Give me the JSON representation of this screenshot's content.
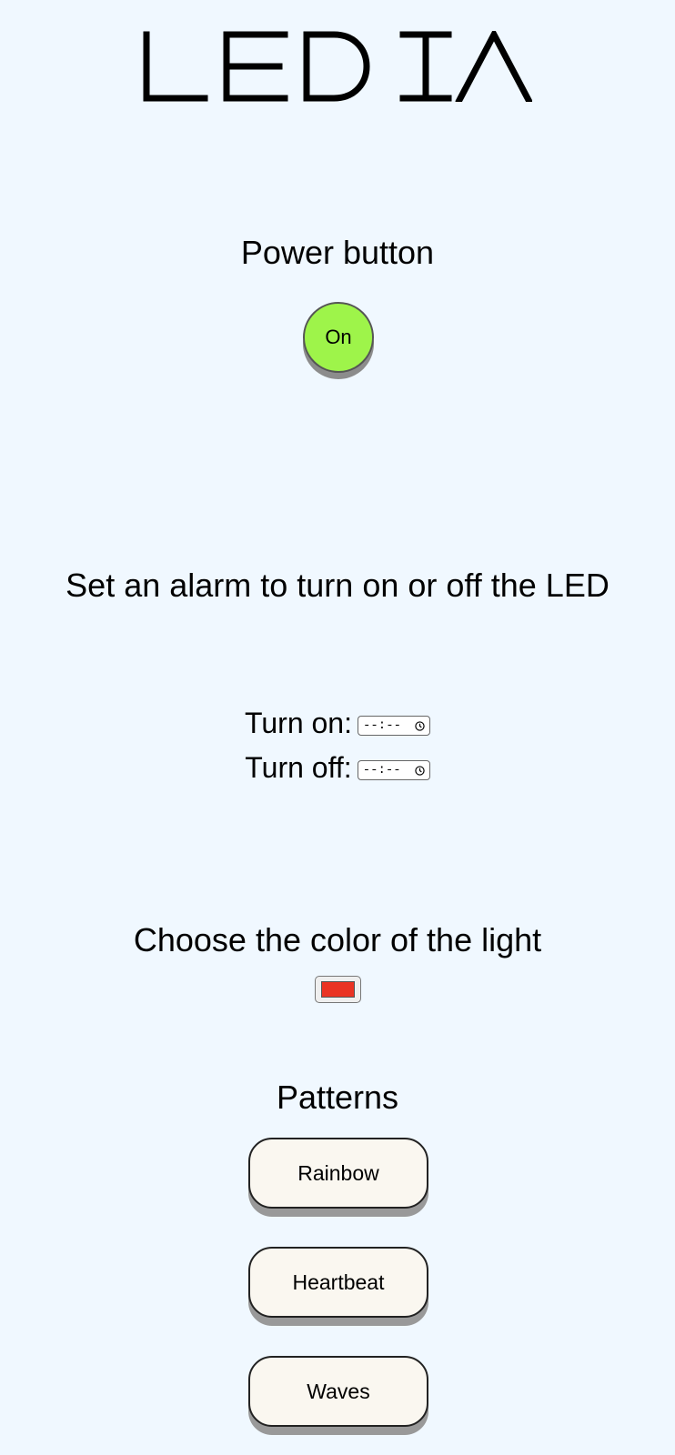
{
  "app": {
    "logo": "LEDIA"
  },
  "power": {
    "heading": "Power button",
    "button_label": "On",
    "button_color": "#9ef44a"
  },
  "alarm": {
    "heading": "Set an alarm to turn on or off the LED",
    "turn_on_label": "Turn on:",
    "turn_on_value": "--:--",
    "turn_off_label": "Turn off:",
    "turn_off_value": "--:--"
  },
  "color": {
    "heading": "Choose the color of the light",
    "value": "#ea3323"
  },
  "patterns": {
    "heading": "Patterns",
    "items": [
      {
        "label": "Rainbow"
      },
      {
        "label": "Heartbeat"
      },
      {
        "label": "Waves"
      }
    ]
  }
}
